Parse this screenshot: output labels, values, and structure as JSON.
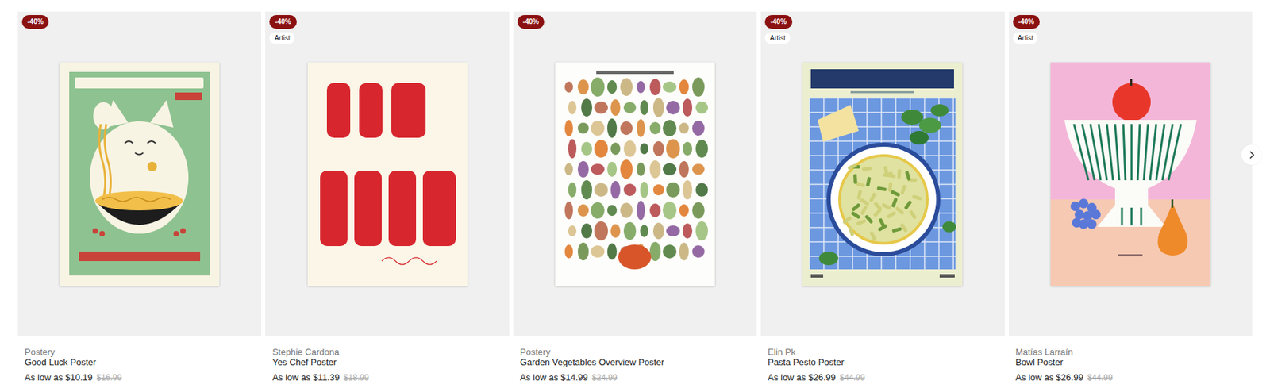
{
  "products": [
    {
      "brand": "Postery",
      "title": "Good Luck Poster",
      "price": "As low as $10.19",
      "old_price": "$16.99",
      "discount": "-40%",
      "labels": [],
      "kind": "cat"
    },
    {
      "brand": "Stephie Cardona",
      "title": "Yes Chef Poster",
      "price": "As low as $11.39",
      "old_price": "$18.99",
      "discount": "-40%",
      "labels": [
        "Artist"
      ],
      "kind": "lettering"
    },
    {
      "brand": "Postery",
      "title": "Garden Vegetables Overview Poster",
      "price": "As low as $14.99",
      "old_price": "$24.99",
      "discount": "-40%",
      "labels": [],
      "kind": "vegetables"
    },
    {
      "brand": "Elin Pk",
      "title": "Pasta Pesto Poster",
      "price": "As low as $26.99",
      "old_price": "$44.99",
      "discount": "-40%",
      "labels": [
        "Artist"
      ],
      "kind": "pasta"
    },
    {
      "brand": "Matías Larraín",
      "title": "Bowl Poster",
      "price": "As low as $26.99",
      "old_price": "$44.99",
      "discount": "-40%",
      "labels": [
        "Artist"
      ],
      "kind": "bowl"
    }
  ]
}
